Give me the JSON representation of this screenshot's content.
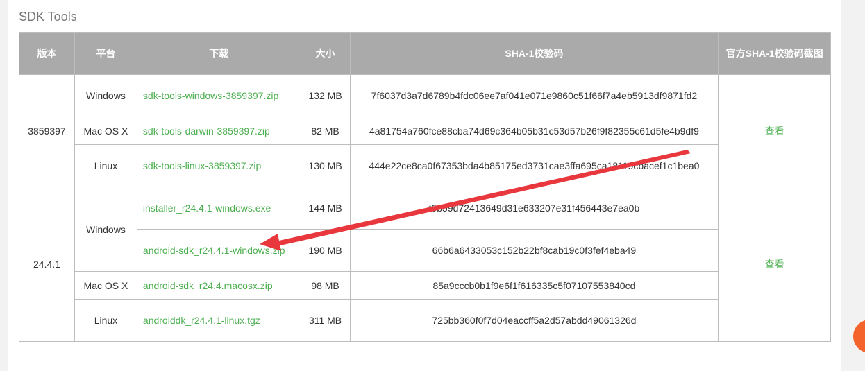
{
  "section_title": "SDK Tools",
  "headers": [
    "版本",
    "平台",
    "下载",
    "大小",
    "SHA-1校验码",
    "官方SHA-1校验码截图"
  ],
  "groups": [
    {
      "version": "3859397",
      "view_label": "查看",
      "rows": [
        {
          "platform": "Windows",
          "file": "sdk-tools-windows-3859397.zip",
          "size": "132 MB",
          "sha1": "7f6037d3a7d6789b4fdc06ee7af041e071e9860c51f66f7a4eb5913df9871fd2"
        },
        {
          "platform": "Mac OS X",
          "file": "sdk-tools-darwin-3859397.zip",
          "size": "82 MB",
          "sha1": "4a81754a760fce88cba74d69c364b05b31c53d57b26f9f82355c61d5fe4b9df9"
        },
        {
          "platform": "Linux",
          "file": "sdk-tools-linux-3859397.zip",
          "size": "130 MB",
          "sha1": "444e22ce8ca0f67353bda4b85175ed3731cae3ffa695ca18119cbacef1c1bea0"
        }
      ]
    },
    {
      "version": "24.4.1",
      "view_label": "查看",
      "rows": [
        {
          "platform": "Windows",
          "file": "installer_r24.4.1-windows.exe",
          "size": "144 MB",
          "sha1": "f9b59d72413649d31e633207e31f456443e7ea0b"
        },
        {
          "platform": "",
          "file": "android-sdk_r24.4.1-windows.zip",
          "size": "190 MB",
          "sha1": "66b6a6433053c152b22bf8cab19c0f3fef4eba49"
        },
        {
          "platform": "Mac OS X",
          "file": "android-sdk_r24.4.macosx.zip",
          "size": "98 MB",
          "sha1": "85a9cccb0b1f9e6f1f616335c5f07107553840cd"
        },
        {
          "platform": "Linux",
          "file": "androiddk_r24.4.1-linux.tgz",
          "size": "311 MB",
          "sha1": "725bb360f0f7d04eaccff5a2d57abdd49061326d"
        }
      ]
    }
  ],
  "colors": {
    "header_bg": "#aaaaaa",
    "link": "#4caf50",
    "arrow": "#e8383d",
    "fab": "#f4632c"
  }
}
